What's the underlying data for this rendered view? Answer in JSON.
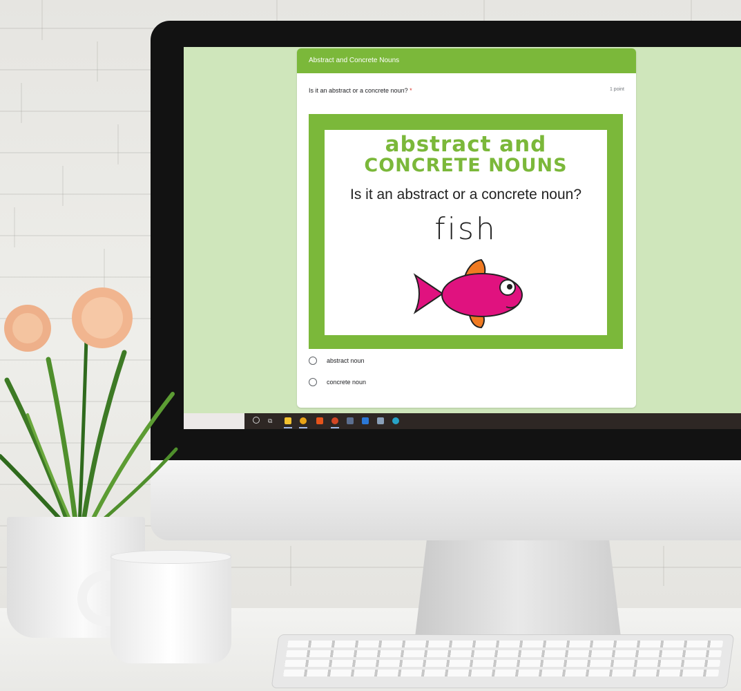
{
  "form": {
    "header_title": "Abstract and Concrete Nouns",
    "question": "Is it an abstract or a concrete noun?",
    "required_mark": "*",
    "points": "1 point",
    "image": {
      "title_line1": "abstract and",
      "title_line2": "CONCRETE NOUNS",
      "question": "Is it an abstract or a concrete noun?",
      "word": "fish",
      "picture": "fish-illustration"
    },
    "options": [
      {
        "label": "abstract noun",
        "selected": false
      },
      {
        "label": "concrete noun",
        "selected": false
      }
    ]
  },
  "taskbar": {
    "icons": [
      "search-icon",
      "task-view-icon",
      "file-explorer-icon",
      "chrome-icon",
      "office-icon",
      "powerpoint-icon",
      "acrobat-icon",
      "mail-icon",
      "app-icon",
      "edge-icon"
    ]
  },
  "colors": {
    "accent_green": "#7bb83a",
    "screen_background": "#cfe6bb",
    "fish_body": "#e0127f",
    "fish_fins": "#f07a22"
  }
}
